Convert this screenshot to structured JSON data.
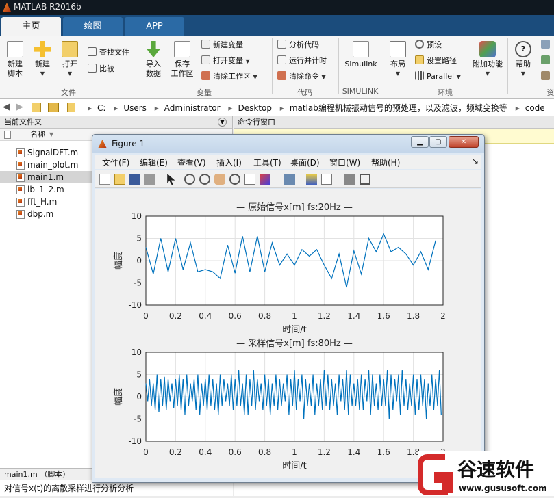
{
  "app": {
    "title": "MATLAB R2016b"
  },
  "tabs": [
    "主页",
    "绘图",
    "APP"
  ],
  "toolstrip": {
    "sections": [
      "文件",
      "变量",
      "代码",
      "SIMULINK",
      "环境"
    ],
    "new_script": "新建\n脚本",
    "new": "新建",
    "open": "打开",
    "find_files": "查找文件",
    "compare": "比较",
    "import_data": "导入\n数据",
    "save_workspace": "保存\n工作区",
    "new_variable": "新建变量",
    "open_variable": "打开变量",
    "clear_workspace": "清除工作区",
    "analyze_code": "分析代码",
    "run_and_time": "运行并计时",
    "clear_commands": "清除命令",
    "simulink": "Simulink",
    "layout": "布局",
    "preferences": "预设",
    "set_path": "设置路径",
    "parallel": "Parallel",
    "addons": "附加功能",
    "help": "帮助",
    "truncated_section": "资"
  },
  "address": {
    "crumbs": [
      "C:",
      "Users",
      "Administrator",
      "Desktop",
      "matlab编程机械振动信号的预处理，以及滤波，频域变换等",
      "code"
    ]
  },
  "filepanel": {
    "title": "当前文件夹",
    "col_name": "名称",
    "files": [
      "SignalDFT.m",
      "main_plot.m",
      "main1.m",
      "lb_1_2.m",
      "fft_H.m",
      "dbp.m"
    ],
    "selected": "main1.m",
    "details": "main1.m （脚本）",
    "description": "对信号x(t)的离散采样进行分析分析"
  },
  "cmdwindow": {
    "title": "命令行窗口"
  },
  "figure": {
    "title": "Figure 1",
    "menu": [
      "文件(F)",
      "编辑(E)",
      "查看(V)",
      "插入(I)",
      "工具(T)",
      "桌面(D)",
      "窗口(W)",
      "帮助(H)"
    ],
    "menu_arrow": "↘"
  },
  "watermark": {
    "brand": "谷速软件",
    "url": "www.gususoft.com"
  },
  "chart_data": [
    {
      "type": "line",
      "title": "— 原始信号x[m] fs:20Hz —",
      "xlabel": "时间/t",
      "ylabel": "幅度",
      "xlim": [
        0,
        2
      ],
      "ylim": [
        -10,
        10
      ],
      "xticks": [
        "0",
        "0.2",
        "0.4",
        "0.6",
        "0.8",
        "1",
        "1.2",
        "1.4",
        "1.6",
        "1.8",
        "2"
      ],
      "yticks": [
        "10",
        "5",
        "0",
        "-5",
        "-10"
      ],
      "grid": true,
      "color": "#0072BD",
      "x": [
        0,
        0.05,
        0.1,
        0.15,
        0.2,
        0.25,
        0.3,
        0.35,
        0.4,
        0.45,
        0.5,
        0.55,
        0.6,
        0.65,
        0.7,
        0.75,
        0.8,
        0.85,
        0.9,
        0.95,
        1.0,
        1.05,
        1.1,
        1.15,
        1.2,
        1.25,
        1.3,
        1.35,
        1.4,
        1.45,
        1.5,
        1.55,
        1.6,
        1.65,
        1.7,
        1.75,
        1.8,
        1.85,
        1.9,
        1.95
      ],
      "y": [
        3,
        -3,
        5,
        -2.5,
        5,
        -2,
        4,
        -2.5,
        -2,
        -2.5,
        -4,
        3.5,
        -2.8,
        5.5,
        -2.5,
        5.5,
        -2.5,
        4,
        -1,
        1.5,
        -1,
        2.5,
        1,
        2.5,
        -1,
        -4,
        1.5,
        -6,
        2.2,
        -3,
        5,
        2,
        6,
        2,
        3,
        1.5,
        -1,
        2,
        -2,
        4.5
      ]
    },
    {
      "type": "line",
      "title": "— 采样信号x[m] fs:80Hz —",
      "xlabel": "时间/t",
      "ylabel": "幅度",
      "xlim": [
        0,
        2
      ],
      "ylim": [
        -10,
        10
      ],
      "xticks": [
        "0",
        "0.2",
        "0.4",
        "0.6",
        "0.8",
        "1",
        "1.2",
        "1.4",
        "1.6",
        "1.8",
        "2"
      ],
      "yticks": [
        "10",
        "5",
        "0",
        "-5",
        "-10"
      ],
      "grid": true,
      "color": "#0072BD",
      "x_step": 0.0125,
      "y": [
        3,
        -1,
        4,
        -2,
        3,
        -3,
        5,
        -3.5,
        4,
        -2,
        4.5,
        -3,
        4,
        -1,
        3,
        -2.5,
        4,
        -2,
        5,
        -3,
        4,
        -4,
        5,
        -2,
        3,
        -1,
        4,
        -3,
        5,
        -4,
        3,
        -2,
        4,
        -3,
        5,
        -2,
        4,
        -3,
        3,
        -4,
        5,
        -2,
        4,
        -1,
        3,
        -2,
        5,
        -3,
        4,
        -2,
        6,
        -2,
        3,
        -4,
        5,
        -4,
        4,
        -2,
        6,
        -3,
        4,
        -1,
        3,
        -3,
        5,
        -2,
        4,
        -4,
        3,
        -2,
        5,
        -3,
        4,
        -2,
        3,
        -1,
        5,
        -4,
        4,
        -2,
        6,
        -3,
        4,
        -1,
        5,
        -5,
        4,
        -2,
        3,
        -2,
        5,
        -4,
        3,
        -2,
        4,
        -3,
        6,
        -2,
        5,
        -3,
        4,
        -2,
        3,
        -4,
        5,
        -1,
        4,
        -3,
        6,
        -4,
        5,
        -2,
        3,
        -2,
        4,
        -3,
        5,
        -3,
        4,
        -1,
        6,
        -4,
        5,
        -2,
        3,
        -3,
        5,
        -2,
        4,
        -2,
        6,
        -5,
        5,
        -3,
        4,
        -1,
        5,
        -4,
        6,
        -2,
        4,
        -3,
        3,
        -2,
        5,
        -4,
        4,
        -3,
        5,
        -2,
        4,
        -5,
        3,
        -2,
        5,
        -3,
        4,
        -2,
        6,
        -4
      ]
    }
  ],
  "colors": {
    "matlab_blue_tabs": "#1b4c7c",
    "plot_line": "#0072BD",
    "watermark_red": "#d42a2a"
  }
}
